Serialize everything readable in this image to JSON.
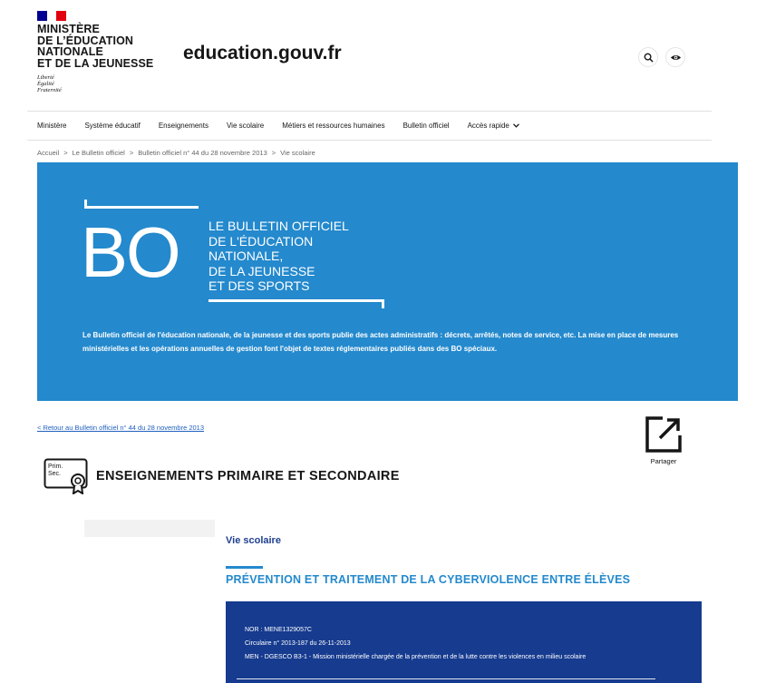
{
  "header": {
    "ministry": "MINISTÈRE\nDE L’ÉDUCATION\nNATIONALE\nET DE LA JEUNESSE",
    "motto": "Liberté\nÉgalité\nFraternité",
    "site_title": "education.gouv.fr",
    "flag_colors": [
      "#000091",
      "#ffffff",
      "#e1000f"
    ],
    "search_icon": "search-icon",
    "accessibility_icon": "eye-icon"
  },
  "nav": {
    "items": [
      "Ministère",
      "Système éducatif",
      "Enseignements",
      "Vie scolaire",
      "Métiers et ressources humaines",
      "Bulletin officiel",
      "Accès rapide"
    ]
  },
  "breadcrumb": {
    "items": [
      "Accueil",
      "Le Bulletin officiel",
      "Bulletin officiel n° 44 du 28 novembre 2013",
      "Vie scolaire"
    ],
    "separator": ">"
  },
  "banner": {
    "big_text": "BO",
    "title": "LE BULLETIN OFFICIEL\nDE L'ÉDUCATION\nNATIONALE,\nDE LA JEUNESSE\nET DES SPORTS",
    "description": "Le Bulletin officiel de l'éducation nationale, de la jeunesse et des sports publie des actes administratifs : décrets, arrêtés, notes de service, etc. La mise en place de mesures ministérielles et les opérations annuelles de gestion font l'objet de textes réglementaires publiés dans des BO spéciaux.",
    "background_color": "#2489cd"
  },
  "back_link": "< Retour au Bulletin officiel n° 44 du 28 novembre 2013",
  "share": {
    "label": "Partager",
    "icon": "share-icon"
  },
  "section": {
    "icon_label_1": "Prim.",
    "icon_label_2": "Sec.",
    "title": "ENSEIGNEMENTS PRIMAIRE ET SECONDAIRE"
  },
  "article": {
    "category": "Vie scolaire",
    "title": "PRÉVENTION ET TRAITEMENT DE LA CYBERVIOLENCE ENTRE ÉLÈVES",
    "title_color": "#2489cd",
    "info": {
      "nor": "NOR : MENE1329057C",
      "circulaire": "Circulaire n° 2013-187 du 26-11-2013",
      "service": "MEN - DGESCO B3-1 - Mission ministérielle chargée de la prévention et de la lutte contre les violences en milieu scolaire",
      "background_color": "#163b8f"
    }
  }
}
